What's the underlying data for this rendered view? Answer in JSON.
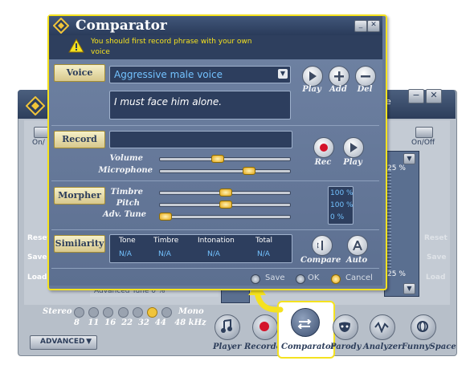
{
  "background_app": {
    "onoff_left": "On/",
    "onoff_right": "On/Off",
    "reset_left": "Reset",
    "save_left": "Save",
    "load_left": "Load",
    "reset_right": "Reset",
    "save_right": "Save",
    "load_right": "Load",
    "pct_top": "25 %",
    "pct_bottom": "25 %",
    "adv_tune_readout": "Advanced Tune 0 %",
    "stereo_label": "Stereo",
    "mono_label": "Mono",
    "khz_values": "8   11  16  22  32  44   48 kHz",
    "advanced_button": "ADVANCED",
    "tools": {
      "player": "Player",
      "recorder": "Recorder",
      "comparator": "Comparator",
      "parody": "Parody",
      "analyzer": "Analyzer",
      "funnyspace": "FunnySpace"
    },
    "title_fragment": "e"
  },
  "dialog": {
    "title": "Comparator",
    "warning_line1": "You should first record phrase with your own",
    "warning_line2": "voice",
    "voice": {
      "section_label": "Voice",
      "selected": "Aggressive male voice",
      "phrase": "I must face him alone.",
      "play_label": "Play",
      "add_label": "Add",
      "del_label": "Del"
    },
    "record": {
      "section_label": "Record",
      "volume_label": "Volume",
      "microphone_label": "Microphone",
      "volume_level": 0.4,
      "microphone_level": 0.67,
      "rec_label": "Rec",
      "play_label": "Play"
    },
    "morpher": {
      "section_label": "Morpher",
      "timbre_label": "Timbre",
      "pitch_label": "Pitch",
      "adv_tune_label": "Adv. Tune",
      "timbre_value": "100 %",
      "pitch_value": "100 %",
      "adv_tune_value": "0 %",
      "timbre_level": 0.5,
      "pitch_level": 0.5,
      "adv_tune_level": 0.0
    },
    "similarity": {
      "section_label": "Similarity",
      "headers": [
        "Tone",
        "Timbre",
        "Intonation",
        "Total"
      ],
      "values": [
        "N/A",
        "N/A",
        "N/A",
        "N/A"
      ],
      "compare_label": "Compare",
      "auto_label": "Auto"
    },
    "footer": {
      "save": "Save",
      "ok": "OK",
      "cancel": "Cancel"
    }
  },
  "colors": {
    "highlight": "#f5e21f",
    "record_dot": "#d4132a",
    "value_text": "#73c2ff"
  }
}
